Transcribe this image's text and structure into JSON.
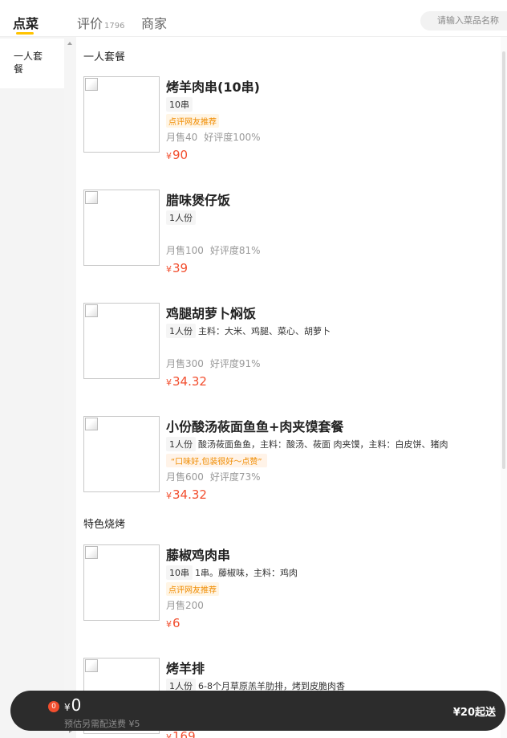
{
  "header": {
    "tabs": [
      {
        "label": "点菜"
      },
      {
        "label": "评价",
        "count": "1796"
      },
      {
        "label": "商家"
      }
    ],
    "search_placeholder": "请输入菜品名称"
  },
  "sidebar": {
    "items": [
      {
        "label": "一人套餐"
      }
    ]
  },
  "sections": [
    {
      "title": "一人套餐",
      "dishes": [
        {
          "name": "烤羊肉串(10串)",
          "spec": "10串",
          "desc": "",
          "badge": "点评网友推荐",
          "monthly": "月售40",
          "rating": "好评度100%",
          "currency": "¥",
          "price": "90"
        },
        {
          "name": "腊味煲仔饭",
          "spec": "1人份",
          "desc": "",
          "badge": "",
          "monthly": "月售100",
          "rating": "好评度81%",
          "currency": "¥",
          "price": "39"
        },
        {
          "name": "鸡腿胡萝卜焖饭",
          "spec": "1人份",
          "desc": "主料：大米、鸡腿、菜心、胡萝卜",
          "badge": "",
          "monthly": "月售300",
          "rating": "好评度91%",
          "currency": "¥",
          "price": "34.32"
        },
        {
          "name": "小份酸汤莜面鱼鱼+肉夹馍套餐",
          "spec": "1人份",
          "desc": "酸汤莜面鱼鱼，主料：酸汤、莜面 肉夹馍，主料：白皮饼、猪肉",
          "quote": "“口味好,包装很好～点赞”",
          "monthly": "月售600",
          "rating": "好评度73%",
          "currency": "¥",
          "price": "34.32"
        }
      ]
    },
    {
      "title": "特色烧烤",
      "dishes": [
        {
          "name": "藤椒鸡肉串",
          "spec": "10串",
          "desc": "1串。藤椒味，主料：鸡肉",
          "badge": "点评网友推荐",
          "monthly": "月售200",
          "rating": "",
          "currency": "¥",
          "price": "6"
        },
        {
          "name": "烤羊排",
          "spec": "1人份",
          "desc": "6-8个月草原羔羊肋排，烤到皮脆肉香",
          "badge": "",
          "monthly": "",
          "rating": "",
          "currency": "¥",
          "price": "169"
        }
      ]
    }
  ],
  "cart": {
    "count": "0",
    "currency": "¥",
    "total": "0",
    "delivery": "预估另需配送费 ¥5",
    "min_order": "¥20起送"
  },
  "colors": {
    "accent": "#ffc300",
    "price": "#f24e2e",
    "cart_bg": "#2c2c2c"
  }
}
